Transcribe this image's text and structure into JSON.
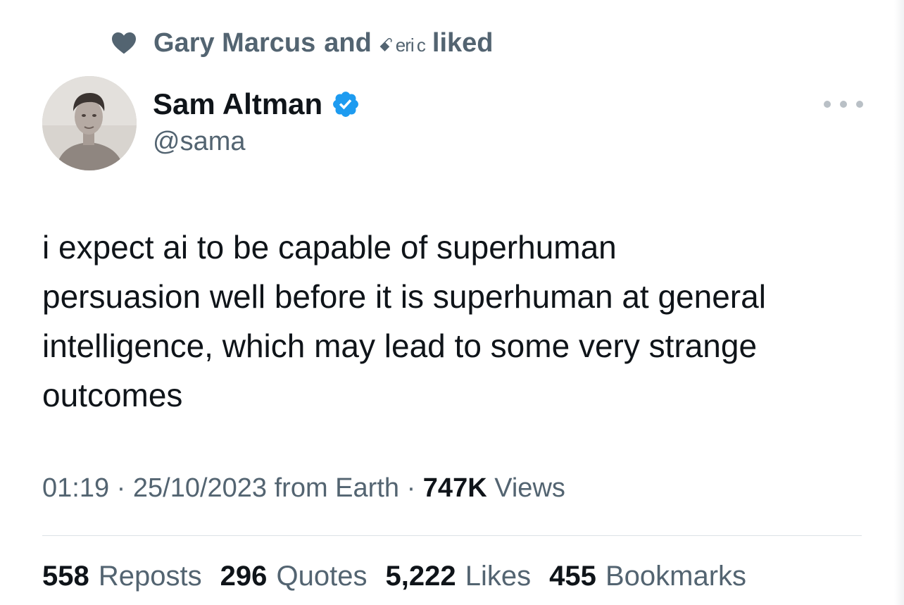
{
  "social_context": {
    "name_primary": "Gary Marcus",
    "connector": "and",
    "name_secondary": "ꗃ eri c",
    "action": "liked",
    "icon": "heart-icon"
  },
  "author": {
    "display_name": "Sam Altman",
    "handle": "@sama",
    "verified_icon": "verified-badge-icon",
    "avatar": "avatar-photo"
  },
  "more_icon": "more-options-icon",
  "tweet": {
    "lines": [
      "i expect ai to be capable of superhuman",
      "persuasion well before it is superhuman at general",
      "intelligence, which may lead to some very strange",
      "outcomes"
    ]
  },
  "meta": {
    "time": "01:19",
    "separator": "·",
    "date": "25/10/2023",
    "source": "from Earth",
    "views_count": "747K",
    "views_label": "Views"
  },
  "stats": {
    "reposts": {
      "count": "558",
      "label": "Reposts"
    },
    "quotes": {
      "count": "296",
      "label": "Quotes"
    },
    "likes": {
      "count": "5,222",
      "label": "Likes"
    },
    "bookmarks": {
      "count": "455",
      "label": "Bookmarks"
    }
  },
  "colors": {
    "text_primary": "#0f1419",
    "text_secondary": "#536471",
    "verified_blue": "#1d9bf0",
    "divider": "#dbe1e6"
  }
}
